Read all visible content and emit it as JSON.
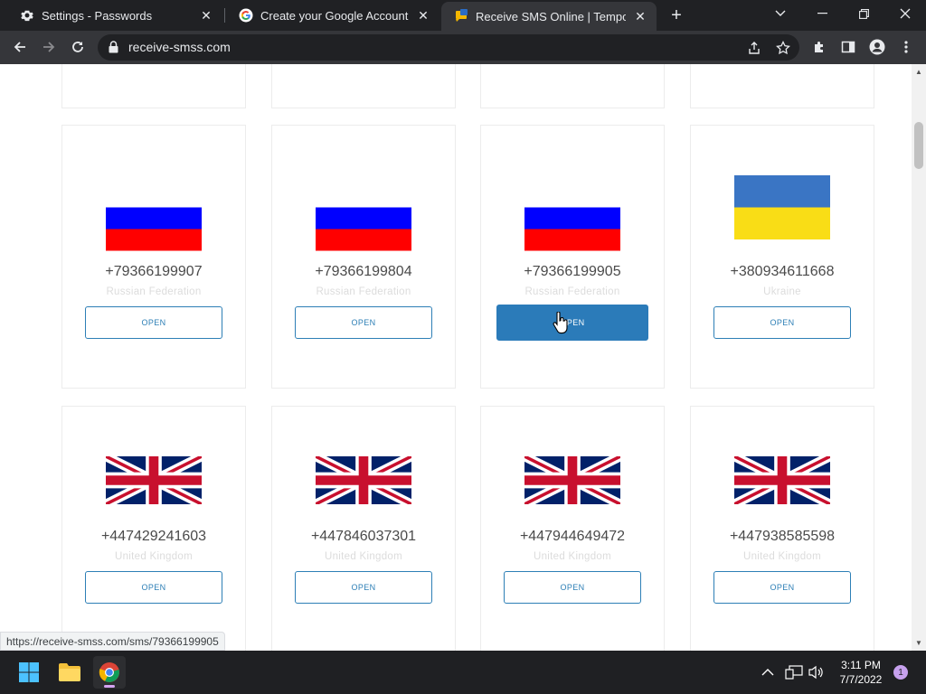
{
  "browser": {
    "tabs": [
      {
        "title": "Settings - Passwords",
        "icon": "gear-icon",
        "active": false
      },
      {
        "title": "Create your Google Account",
        "icon": "google-icon",
        "active": false
      },
      {
        "title": "Receive SMS Online | Temporary",
        "icon": "receive-sms-icon",
        "active": true
      }
    ],
    "url": "receive-smss.com",
    "status_url": "https://receive-smss.com/sms/79366199905"
  },
  "cards": [
    {
      "phone": "+79366199907",
      "country": "Russian Federation",
      "flag": "russia",
      "button": "OPEN"
    },
    {
      "phone": "+79366199804",
      "country": "Russian Federation",
      "flag": "russia",
      "button": "OPEN"
    },
    {
      "phone": "+79366199905",
      "country": "Russian Federation",
      "flag": "russia",
      "button": "OPEN",
      "hovered": true
    },
    {
      "phone": "+380934611668",
      "country": "Ukraine",
      "flag": "ukraine",
      "button": "OPEN"
    },
    {
      "phone": "+447429241603",
      "country": "United Kingdom",
      "flag": "uk",
      "button": "OPEN"
    },
    {
      "phone": "+447846037301",
      "country": "United Kingdom",
      "flag": "uk",
      "button": "OPEN"
    },
    {
      "phone": "+447944649472",
      "country": "United Kingdom",
      "flag": "uk",
      "button": "OPEN"
    },
    {
      "phone": "+447938585598",
      "country": "United Kingdom",
      "flag": "uk",
      "button": "OPEN"
    }
  ],
  "taskbar": {
    "time": "3:11 PM",
    "date": "7/7/2022",
    "notifications": "1"
  },
  "colors": {
    "accent": "#2b7bb9",
    "russia_white": "#ffffff",
    "russia_blue": "#0000ff",
    "russia_red": "#ff0000",
    "ukraine_blue": "#3a75c4",
    "ukraine_yellow": "#f9dd16",
    "uk_blue": "#012169",
    "uk_red": "#c8102e"
  }
}
